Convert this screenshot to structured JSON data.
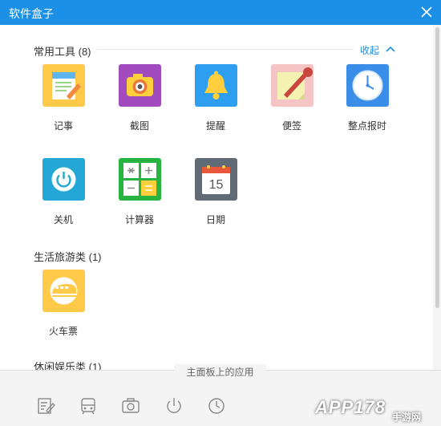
{
  "window": {
    "title": "软件盒子",
    "accent": "#1c8fe6"
  },
  "sections": {
    "common": {
      "title": "常用工具 (8)",
      "collapse_label": "收起",
      "apps": [
        {
          "label": "记事",
          "icon": "notepad-icon",
          "color": "#ffc94a"
        },
        {
          "label": "截图",
          "icon": "camera-icon",
          "color": "#a24bbf"
        },
        {
          "label": "提醒",
          "icon": "bell-icon",
          "color": "#2d9ef0"
        },
        {
          "label": "便签",
          "icon": "sticky-note-icon",
          "color": "#f5c4c4"
        },
        {
          "label": "整点报时",
          "icon": "clock-icon",
          "color": "#3a8ee8"
        },
        {
          "label": "关机",
          "icon": "power-icon",
          "color": "#24a6d6"
        },
        {
          "label": "计算器",
          "icon": "calculator-icon",
          "color": "#28b440"
        },
        {
          "label": "日期",
          "icon": "calendar-icon",
          "color": "#616b75"
        }
      ],
      "calendar_day": "15"
    },
    "travel": {
      "title": "生活旅游类 (1)",
      "apps": [
        {
          "label": "火车票",
          "icon": "train-icon",
          "color": "#ffc94a"
        }
      ]
    },
    "leisure": {
      "title": "休闲娱乐类 (1)"
    }
  },
  "bottom_panel": {
    "label": "主面板上的应用",
    "icons": [
      "notepad-icon",
      "train-icon",
      "camera-icon",
      "power-icon",
      "clock-icon"
    ]
  },
  "watermark": {
    "main": "APP178",
    "sub": "手游网"
  }
}
